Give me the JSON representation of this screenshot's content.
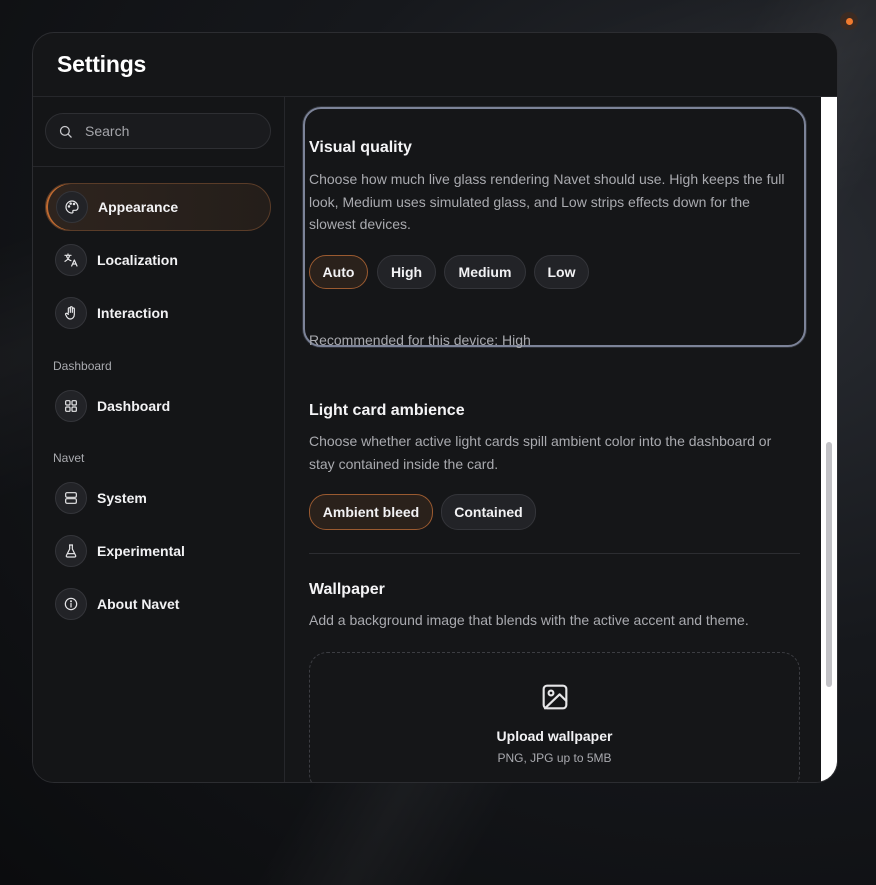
{
  "window": {
    "title": "Settings"
  },
  "search": {
    "placeholder": "Search"
  },
  "sidebar": {
    "items": [
      {
        "label": "Appearance",
        "icon": "palette-icon",
        "active": true
      },
      {
        "label": "Localization",
        "icon": "translate-icon",
        "active": false
      },
      {
        "label": "Interaction",
        "icon": "hand-icon",
        "active": false
      }
    ],
    "sections": [
      {
        "title": "Dashboard",
        "items": [
          {
            "label": "Dashboard",
            "icon": "grid-icon"
          }
        ]
      },
      {
        "title": "Navet",
        "items": [
          {
            "label": "System",
            "icon": "server-icon"
          },
          {
            "label": "Experimental",
            "icon": "flask-icon"
          },
          {
            "label": "About Navet",
            "icon": "info-icon"
          }
        ]
      }
    ]
  },
  "visual_quality": {
    "title": "Visual quality",
    "description": "Choose how much live glass rendering Navet should use. High keeps the full look, Medium uses simulated glass, and Low strips effects down for the slowest devices.",
    "options": [
      "Auto",
      "High",
      "Medium",
      "Low"
    ],
    "selected": "Auto",
    "recommendation": "Recommended for this device: High"
  },
  "light_card_ambience": {
    "title": "Light card ambience",
    "description": "Choose whether active light cards spill ambient color into the dashboard or stay contained inside the card.",
    "options": [
      "Ambient bleed",
      "Contained"
    ],
    "selected": "Ambient bleed"
  },
  "wallpaper": {
    "title": "Wallpaper",
    "description": "Add a background image that blends with the active accent and theme.",
    "upload_label": "Upload wallpaper",
    "upload_hint": "PNG, JPG up to 5MB"
  },
  "colors": {
    "accent": "#f07a2e",
    "selected_border": "#9a5a30",
    "window_bg": "#151618",
    "focus_ring": "#7c8398"
  }
}
